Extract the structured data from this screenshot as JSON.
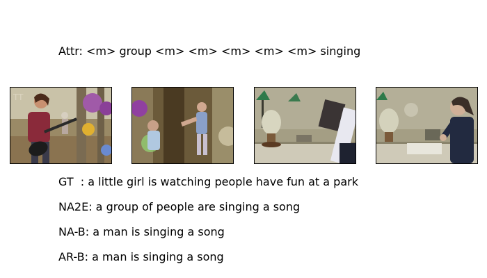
{
  "figure": {
    "attr_text": "Attr: <m> group <m> <m> <m> <m> <m> singing",
    "captions": {
      "gt": "GT  : a little girl is watching people have fun at a park",
      "na2e": "NA2E: a group of people are singing a song",
      "na_b": "NA-B: a man is singing a song",
      "ar_b": "AR-B: a man is singing a song"
    },
    "frames": [
      {
        "name": "video-frame-1",
        "description_icon": "woman-guitar-park-frame"
      },
      {
        "name": "video-frame-2",
        "description_icon": "children-playing-park-frame"
      },
      {
        "name": "video-frame-3",
        "description_icon": "desk-lamp-room-frame"
      },
      {
        "name": "video-frame-4",
        "description_icon": "woman-at-desk-frame"
      }
    ]
  }
}
